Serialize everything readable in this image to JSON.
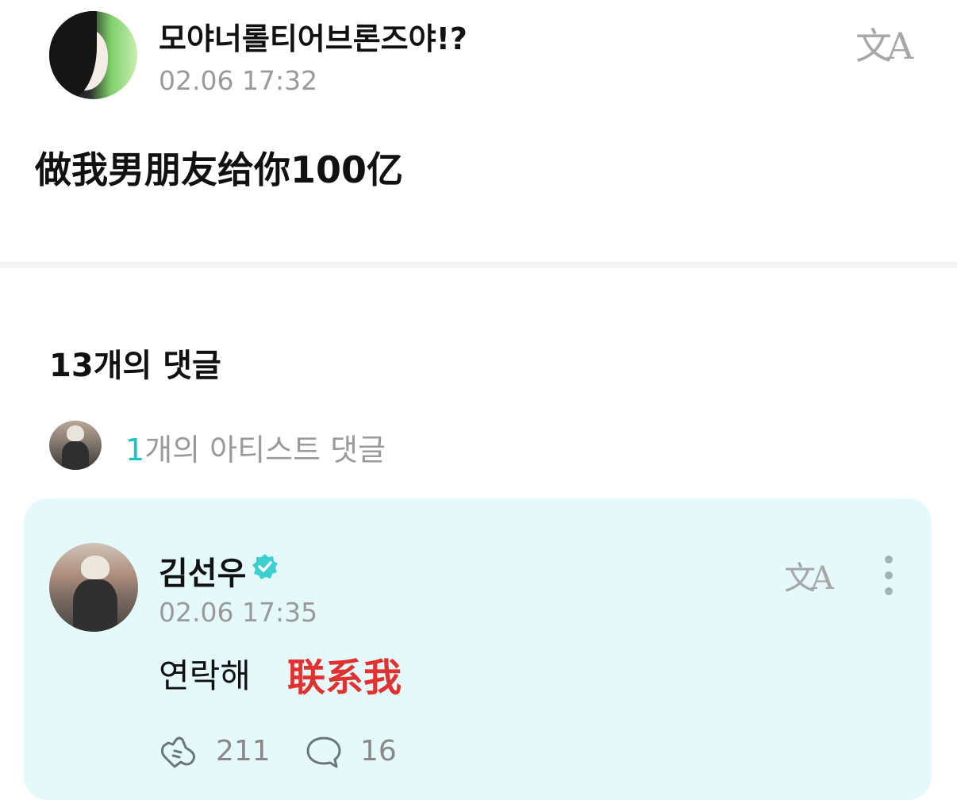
{
  "post": {
    "author": "모야너롤티어브론즈야!?",
    "time": "02.06 17:32",
    "translate_icon": "文A",
    "body": "做我男朋友给你100亿"
  },
  "comments": {
    "count_label": "13개의 댓글",
    "artist_summary": {
      "number": "1",
      "text": "개의 아티스트 댓글"
    }
  },
  "artist_comment": {
    "author": "김선우",
    "time": "02.06 17:35",
    "translate_icon": "文A",
    "body": "연락해",
    "overlay_caption": "联系我",
    "likes": "211",
    "replies": "16"
  },
  "colors": {
    "accent": "#1bc2c6",
    "card_background": "#e5f9fb",
    "overlay_red": "#e13131"
  },
  "icons": {
    "translate": "translate-icon",
    "verified": "verified-badge-icon",
    "more": "more-vertical-icon",
    "like": "like-icon",
    "reply": "reply-bubble-icon"
  }
}
